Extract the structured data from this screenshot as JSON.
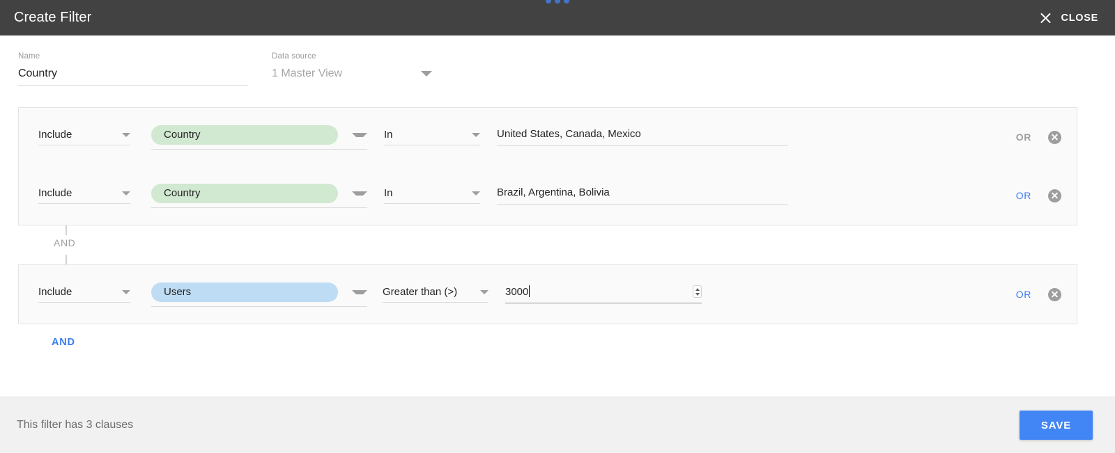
{
  "header": {
    "title": "Create Filter",
    "close_label": "CLOSE",
    "close_icon": "close-icon",
    "drag_dots_icon": "more-dots-icon"
  },
  "fields": {
    "name": {
      "caption": "Name",
      "value": "Country"
    },
    "data_source": {
      "caption": "Data source",
      "value": "1 Master View",
      "dropdown_icon": "chevron-down-icon"
    }
  },
  "clause_groups": [
    {
      "rows": [
        {
          "include": "Include",
          "field": "Country",
          "field_color": "green",
          "operator": "In",
          "value": "United States, Canada, Mexico",
          "value_type": "text",
          "or_label": "OR",
          "or_active": false,
          "remove_icon": "remove-clause-icon"
        },
        {
          "include": "Include",
          "field": "Country",
          "field_color": "green",
          "operator": "In",
          "value": "Brazil, Argentina, Bolivia",
          "value_type": "text",
          "or_label": "OR",
          "or_active": true,
          "remove_icon": "remove-clause-icon"
        }
      ]
    },
    {
      "rows": [
        {
          "include": "Include",
          "field": "Users",
          "field_color": "blue",
          "operator": "Greater than (>)",
          "value": "3000",
          "value_type": "number",
          "focused": true,
          "or_label": "OR",
          "or_active": true,
          "remove_icon": "remove-clause-icon"
        }
      ]
    }
  ],
  "connector": {
    "and_label": "AND",
    "add_and_label": "AND"
  },
  "footer": {
    "status": "This filter has 3 clauses",
    "save_label": "SAVE"
  },
  "colors": {
    "topbar": "#424242",
    "accent_blue": "#4285f4",
    "pill_green": "#d1e8d1",
    "pill_blue": "#bedcf3",
    "footer_bg": "#f1f1f1",
    "group_bg": "#fafafa"
  }
}
